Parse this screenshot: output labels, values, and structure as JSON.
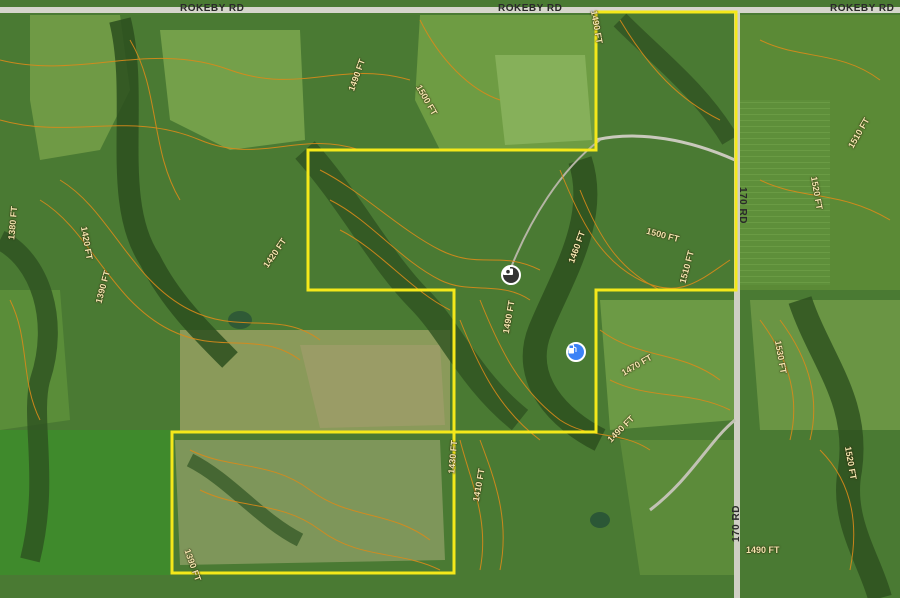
{
  "colors": {
    "boundary": "#f4e81a",
    "contour": "#d98a1a",
    "road": "#d8d8d0",
    "marker_dark": "#333333",
    "marker_blue": "#3b82f6"
  },
  "roads": {
    "north_a": "ROKEBY RD",
    "north_b": "ROKEBY RD",
    "north_c": "ROKEBY RD",
    "east_lower": "170 RD",
    "east_upper": "170 RD"
  },
  "contours": {
    "c1": "1490 FT",
    "c2": "1500 FT",
    "c3": "1490 FT",
    "c4": "1510 FT",
    "c5": "1520 FT",
    "c6": "1380 FT",
    "c7": "1420 FT",
    "c8": "1390 FT",
    "c9": "1420 FT",
    "c10": "1460 FT",
    "c11": "1500 FT",
    "c12": "1510 FT",
    "c13": "1490 FT",
    "c14": "1530 FT",
    "c15": "1470 FT",
    "c16": "1490 FT",
    "c17": "1410 FT",
    "c18": "1430 FT",
    "c19": "1520 FT",
    "c20": "1490 FT",
    "c21": "1390 FT"
  },
  "markers": {
    "camera_icon": "camera-icon",
    "water_icon": "fuel-pump-icon"
  }
}
